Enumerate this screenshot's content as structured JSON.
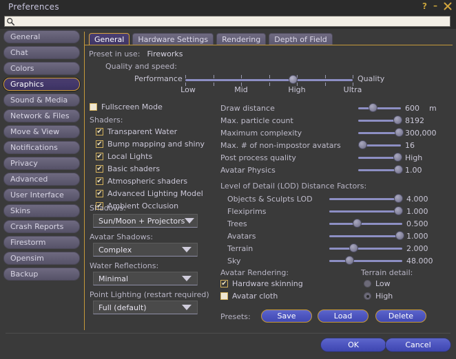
{
  "window": {
    "title": "Preferences",
    "help_icon": "question-mark-icon",
    "minimize_icon": "minimize-icon",
    "close_icon": "close-icon"
  },
  "search": {
    "value": "",
    "placeholder": "",
    "icon": "search-icon"
  },
  "sidebar": {
    "items": [
      {
        "label": "General",
        "selected": false
      },
      {
        "label": "Chat",
        "selected": false
      },
      {
        "label": "Colors",
        "selected": false
      },
      {
        "label": "Graphics",
        "selected": true
      },
      {
        "label": "Sound & Media",
        "selected": false
      },
      {
        "label": "Network & Files",
        "selected": false
      },
      {
        "label": "Move & View",
        "selected": false
      },
      {
        "label": "Notifications",
        "selected": false
      },
      {
        "label": "Privacy",
        "selected": false
      },
      {
        "label": "Advanced",
        "selected": false
      },
      {
        "label": "User Interface",
        "selected": false
      },
      {
        "label": "Skins",
        "selected": false
      },
      {
        "label": "Crash Reports",
        "selected": false
      },
      {
        "label": "Firestorm",
        "selected": false
      },
      {
        "label": "Opensim",
        "selected": false
      },
      {
        "label": "Backup",
        "selected": false
      }
    ]
  },
  "tabs": [
    {
      "label": "General",
      "active": true
    },
    {
      "label": "Hardware Settings",
      "active": false
    },
    {
      "label": "Rendering",
      "active": false
    },
    {
      "label": "Depth of Field",
      "active": false
    }
  ],
  "preset": {
    "label": "Preset in use:",
    "value": "Fireworks"
  },
  "quality": {
    "section_label": "Quality and speed:",
    "left_label": "Performance",
    "right_label": "Quality",
    "scale_labels": [
      "Low",
      "Mid",
      "High",
      "Ultra"
    ],
    "value_percent": 64,
    "refresh_icon": "refresh-icon"
  },
  "fullscreen": {
    "label": "Fullscreen Mode",
    "checked": false
  },
  "shaders": {
    "group_label": "Shaders:",
    "items": [
      {
        "label": "Transparent Water",
        "checked": true
      },
      {
        "label": "Bump mapping and shiny",
        "checked": true
      },
      {
        "label": "Local Lights",
        "checked": true
      },
      {
        "label": "Basic shaders",
        "checked": true
      },
      {
        "label": "Atmospheric shaders",
        "checked": true
      },
      {
        "label": "Advanced Lighting Model",
        "checked": true
      },
      {
        "label": "Ambient Occlusion",
        "checked": true
      }
    ]
  },
  "dropdowns": [
    {
      "label": "Shadows:",
      "value": "Sun/Moon + Projectors"
    },
    {
      "label": "Avatar Shadows:",
      "value": "Complex"
    },
    {
      "label": "Water Reflections:",
      "value": "Minimal"
    },
    {
      "label": "Point Lighting (restart required)",
      "value": "Full (default)"
    }
  ],
  "settings_sliders": [
    {
      "label": "Draw distance",
      "value": "600",
      "unit": "m",
      "fill_percent": 34
    },
    {
      "label": "Max. particle count",
      "value": "8192",
      "unit": "",
      "fill_percent": 92
    },
    {
      "label": "Maximum complexity",
      "value": "300,000",
      "unit": "",
      "fill_percent": 95
    },
    {
      "label": "Max. # of non-impostor avatars",
      "value": "16",
      "unit": "",
      "fill_percent": 9
    },
    {
      "label": "Post process quality",
      "value": "High",
      "unit": "",
      "fill_percent": 92
    },
    {
      "label": "Avatar Physics",
      "value": "1.00",
      "unit": "",
      "fill_percent": 94
    }
  ],
  "lod": {
    "group_label": "Level of Detail (LOD) Distance Factors:",
    "sliders": [
      {
        "label": "Objects & Sculpts LOD",
        "value": "4.000",
        "fill_percent": 94
      },
      {
        "label": "Flexiprims",
        "value": "1.000",
        "fill_percent": 94
      },
      {
        "label": "Trees",
        "value": "0.500",
        "fill_percent": 38
      },
      {
        "label": "Avatars",
        "value": "1.000",
        "fill_percent": 96
      },
      {
        "label": "Terrain",
        "value": "2.000",
        "fill_percent": 33
      },
      {
        "label": "Sky",
        "value": "48.000",
        "fill_percent": 27
      }
    ]
  },
  "avatar_rendering": {
    "group_label": "Avatar Rendering:",
    "items": [
      {
        "label": "Hardware skinning",
        "checked": true
      },
      {
        "label": "Avatar cloth",
        "checked": false
      }
    ]
  },
  "terrain_detail": {
    "group_label": "Terrain detail:",
    "options": [
      {
        "label": "Low",
        "selected": false
      },
      {
        "label": "High",
        "selected": true
      }
    ]
  },
  "presets": {
    "label": "Presets:",
    "buttons": [
      "Save",
      "Load",
      "Delete"
    ]
  },
  "dialog_buttons": [
    "OK",
    "Cancel"
  ]
}
